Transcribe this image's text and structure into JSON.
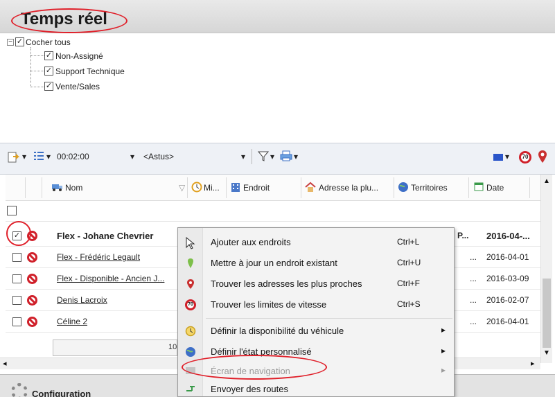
{
  "header": {
    "title": "Temps réel"
  },
  "tree": {
    "root_label": "Cocher tous",
    "items": [
      {
        "label": "Non-Assigné"
      },
      {
        "label": "Support Technique"
      },
      {
        "label": "Vente/Sales"
      }
    ]
  },
  "toolbar": {
    "interval": "00:02:00",
    "source": "<Astus>"
  },
  "grid": {
    "columns": [
      {
        "label": "Nom"
      },
      {
        "label": "Mi..."
      },
      {
        "label": "Endroit"
      },
      {
        "label": "Adresse la plu..."
      },
      {
        "label": "Territoires"
      },
      {
        "label": "Date"
      }
    ],
    "rows": [
      {
        "name": "Flex - Johane Chevrier",
        "col5": "P...",
        "date": "2016-04-..."
      },
      {
        "name": "Flex - Frédéric Legault",
        "col5": "...",
        "date": "2016-04-01"
      },
      {
        "name": "Flex - Disponible - Ancien J...",
        "col5": "...",
        "date": "2016-03-09"
      },
      {
        "name": "Denis Lacroix",
        "col5": "...",
        "date": "2016-02-07"
      },
      {
        "name": "Céline 2",
        "col5": "...",
        "date": "2016-04-01"
      }
    ],
    "summary_text": "10"
  },
  "footer": {
    "label": "Configuration"
  },
  "context_menu": {
    "items": [
      {
        "label": "Ajouter aux endroits",
        "shortcut": "Ctrl+L"
      },
      {
        "label": "Mettre à jour un endroit existant",
        "shortcut": "Ctrl+U"
      },
      {
        "label": "Trouver les adresses les plus proches",
        "shortcut": "Ctrl+F"
      },
      {
        "label": "Trouver les limites de vitesse",
        "shortcut": "Ctrl+S"
      },
      {
        "label": "Définir la disponibilité du véhicule",
        "arrow": "▸"
      },
      {
        "label": "Définir l'état personnalisé",
        "arrow": "▸"
      },
      {
        "label": "Écran de navigation",
        "arrow": "▸",
        "disabled": true
      },
      {
        "label": "Envoyer des routes"
      }
    ]
  },
  "colors": {
    "highlight_red": "#e0202a",
    "toolbar_bg": "#eef1f6"
  }
}
